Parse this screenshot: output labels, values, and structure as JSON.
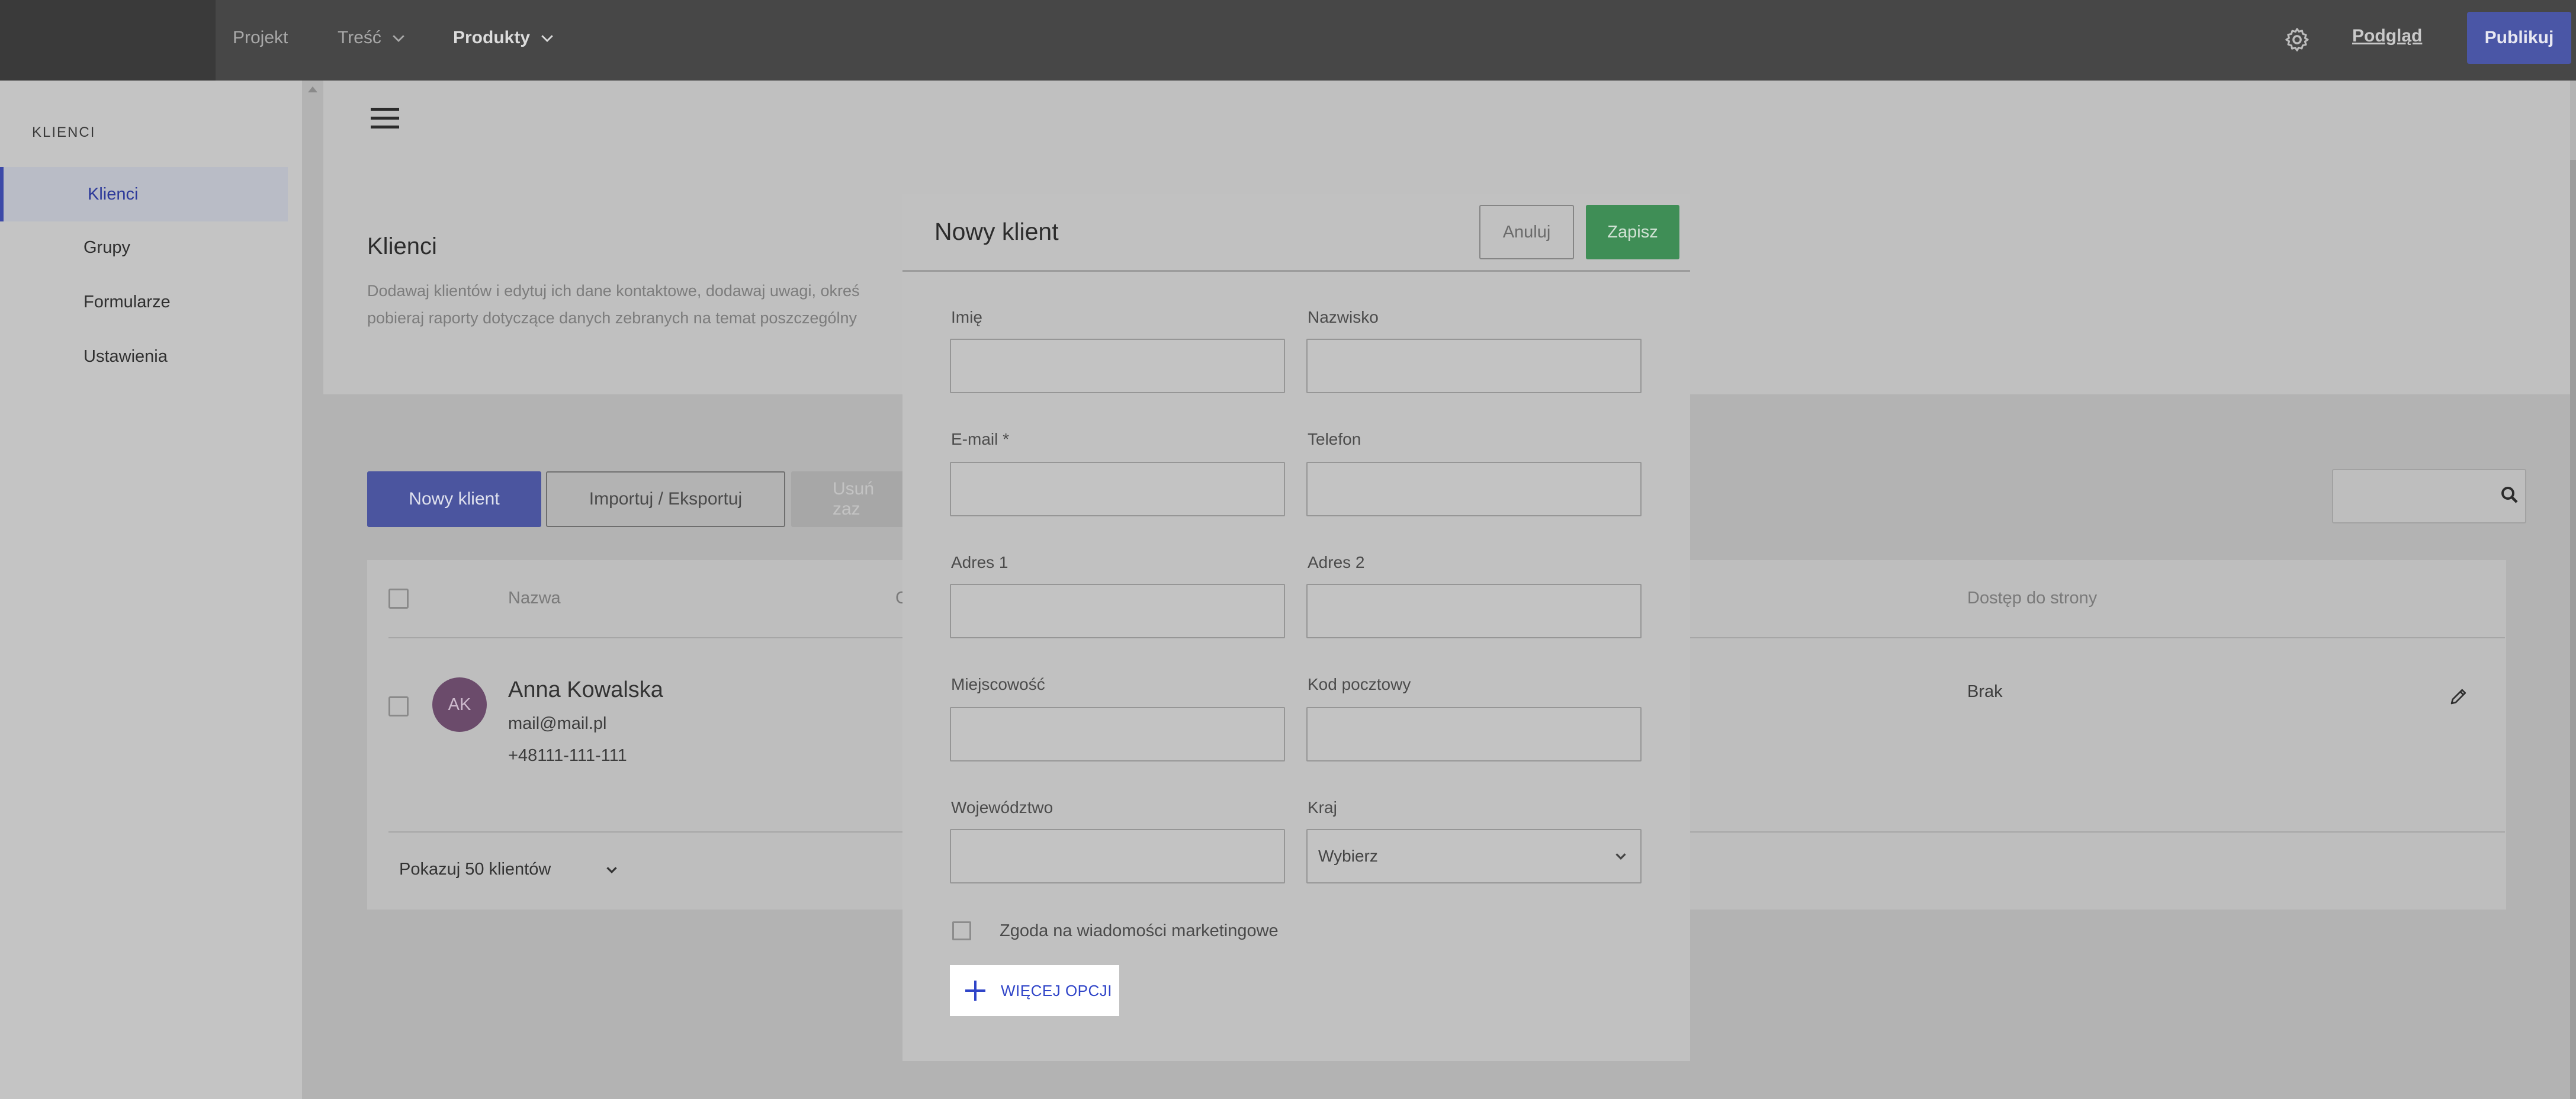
{
  "topbar": {
    "nav": [
      {
        "label": "Projekt"
      },
      {
        "label": "Treść"
      },
      {
        "label": "Produkty"
      }
    ],
    "preview_label": "Podgląd",
    "publish_label": "Publikuj"
  },
  "sidebar": {
    "heading": "KLIENCI",
    "items": [
      {
        "label": "Klienci",
        "active": true
      },
      {
        "label": "Grupy"
      },
      {
        "label": "Formularze"
      },
      {
        "label": "Ustawienia"
      }
    ]
  },
  "page": {
    "title": "Klienci",
    "description_line1": "Dodawaj klientów i edytuj ich dane kontaktowe, dodawaj uwagi, okreś",
    "description_line2": "pobieraj raporty dotyczące danych zebranych na temat poszczególny"
  },
  "toolbar": {
    "new_client_label": "Nowy klient",
    "import_export_label": "Importuj / Eksportuj",
    "delete_label": "Usuń zaz"
  },
  "table": {
    "columns": [
      "Nazwa",
      "Dostęp do strony"
    ],
    "partial_column_letter": "C",
    "rows": [
      {
        "initials": "AK",
        "name": "Anna Kowalska",
        "email": "mail@mail.pl",
        "phone": "+48111-111-111",
        "access": "Brak"
      }
    ],
    "page_size_label": "Pokazuj 50 klientów"
  },
  "modal": {
    "title": "Nowy klient",
    "cancel_label": "Anuluj",
    "save_label": "Zapisz",
    "fields": {
      "first_name": {
        "label": "Imię",
        "value": ""
      },
      "last_name": {
        "label": "Nazwisko",
        "value": ""
      },
      "email": {
        "label": "E-mail *",
        "value": ""
      },
      "phone": {
        "label": "Telefon",
        "value": ""
      },
      "address1": {
        "label": "Adres 1",
        "value": ""
      },
      "address2": {
        "label": "Adres 2",
        "value": ""
      },
      "city": {
        "label": "Miejscowość",
        "value": ""
      },
      "zip": {
        "label": "Kod pocztowy",
        "value": ""
      },
      "region": {
        "label": "Województwo",
        "value": ""
      },
      "country": {
        "label": "Kraj",
        "selected": "Wybierz"
      }
    },
    "consent_label": "Zgoda na wiadomości marketingowe",
    "more_options_label": "WIĘCEJ OPCJI"
  },
  "colors": {
    "accent": "#5561c6",
    "save_green": "#54b56e",
    "link_blue": "#2f44c8",
    "overlay_dim": "rgba(0,0,0,0.25)"
  },
  "icons": [
    "chevron-down-icon",
    "gear-icon",
    "hamburger-icon",
    "search-icon",
    "pencil-icon",
    "plus-icon"
  ]
}
